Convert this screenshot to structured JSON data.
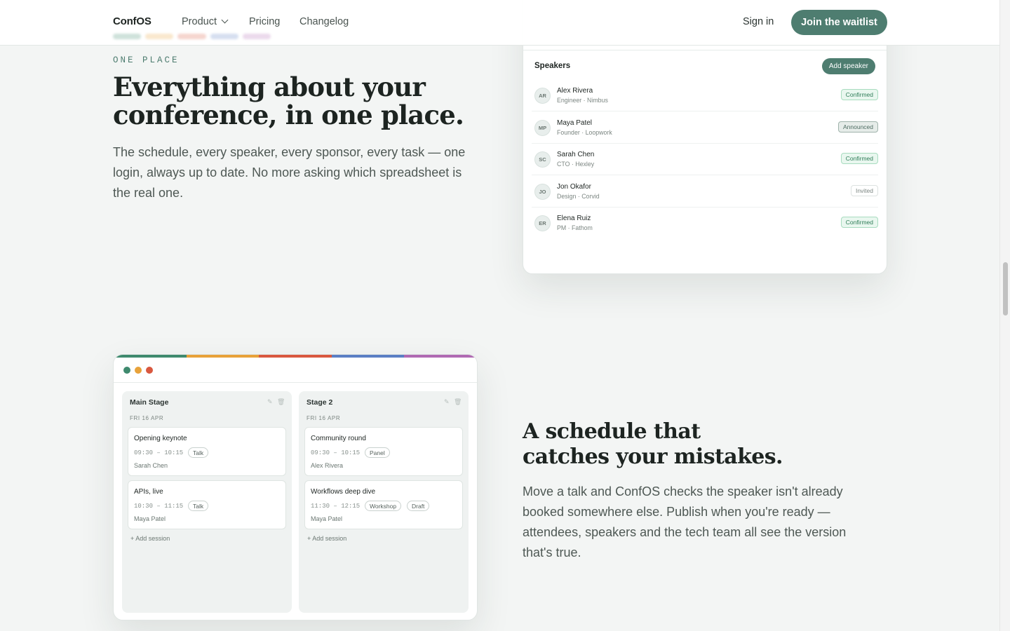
{
  "nav": {
    "brand": "ConfOS",
    "product": "Product",
    "pricing": "Pricing",
    "changelog": "Changelog",
    "sign_in": "Sign in",
    "cta": "Join the waitlist"
  },
  "section_one": {
    "eyebrow": "ONE PLACE",
    "heading": "Everything about your conference, in one place.",
    "body": "The schedule, every speaker, every sponsor, every task — one login, always up to date. No more asking which spreadsheet is the real one."
  },
  "speakers": {
    "title": "Speakers",
    "add_button": "Add speaker",
    "rows": [
      {
        "initials": "AR",
        "name": "Alex Rivera",
        "role": "Engineer · Nimbus",
        "status": "Confirmed"
      },
      {
        "initials": "MP",
        "name": "Maya Patel",
        "role": "Founder · Loopwork",
        "status": "Announced"
      },
      {
        "initials": "SC",
        "name": "Sarah Chen",
        "role": "CTO · Hexley",
        "status": "Confirmed"
      },
      {
        "initials": "JO",
        "name": "Jon Okafor",
        "role": "Design · Corvid",
        "status": "Invited"
      },
      {
        "initials": "ER",
        "name": "Elena Ruiz",
        "role": "PM · Fathom",
        "status": "Confirmed"
      }
    ]
  },
  "schedule": {
    "accent_colors": [
      "#3f8a6e",
      "#e8a23a",
      "#d9583f",
      "#5b7fc4",
      "#b06ab3"
    ],
    "window_dots": [
      "#3f8a6e",
      "#e8a23a",
      "#d9583f"
    ],
    "stages": [
      {
        "name": "Main Stage",
        "date": "FRI 16 APR",
        "sessions": [
          {
            "title": "Opening keynote",
            "time": "09:30 – 10:15",
            "tags": [
              "Talk"
            ],
            "speaker": "Sarah Chen"
          },
          {
            "title": "APIs, live",
            "time": "10:30 – 11:15",
            "tags": [
              "Talk"
            ],
            "speaker": "Maya Patel"
          }
        ],
        "add_label": "+ Add session"
      },
      {
        "name": "Stage 2",
        "date": "FRI 16 APR",
        "sessions": [
          {
            "title": "Community round",
            "time": "09:30 – 10:15",
            "tags": [
              "Panel"
            ],
            "speaker": "Alex Rivera"
          },
          {
            "title": "Workflows deep dive",
            "time": "11:30 – 12:15",
            "tags": [
              "Workshop",
              "Draft"
            ],
            "speaker": "Maya Patel"
          }
        ],
        "add_label": "+ Add session"
      }
    ]
  },
  "section_two": {
    "heading_line1": "A schedule that",
    "heading_line2": "catches your mistakes.",
    "body": "Move a talk and ConfOS checks the speaker isn't already booked somewhere else. Publish when you're ready — attendees, speakers and the tech team all see the version that's true."
  },
  "colors": {
    "brand": "#4e7d70",
    "background": "#f3f5f4"
  }
}
